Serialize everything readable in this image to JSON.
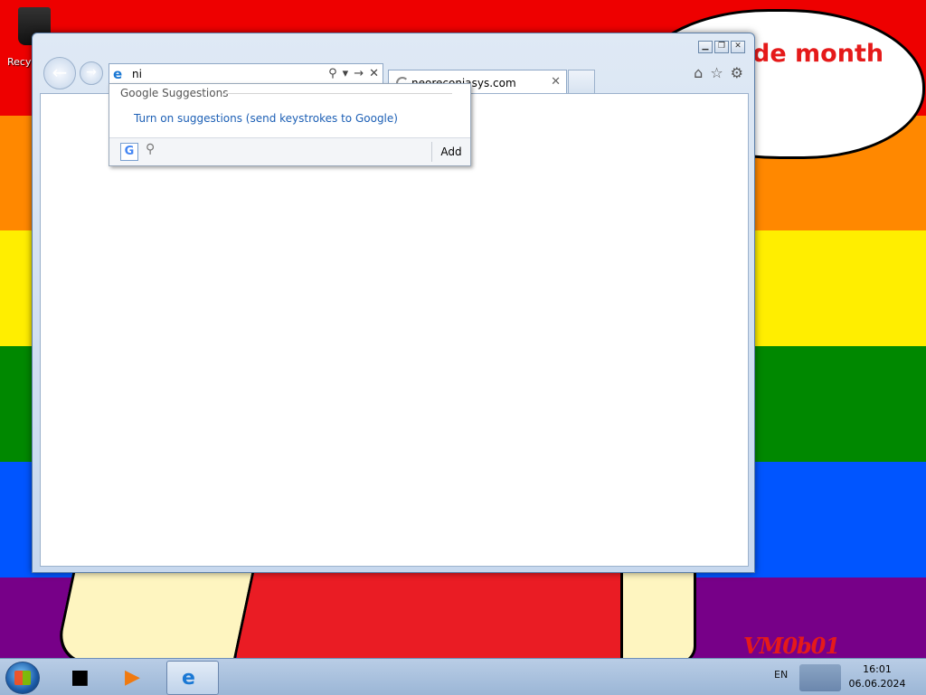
{
  "desktop": {
    "recycle_bin_label": "Recy",
    "wallpaper_text": "de month",
    "wallpaper_text2": "!",
    "signature": "VM0b01"
  },
  "browser": {
    "address_value": "ni",
    "tab_title": "neoreconiasys.com",
    "window_controls": [
      "minimize-icon",
      "restore-icon",
      "close-icon"
    ],
    "right_tools": [
      "home-icon",
      "favorites-star-icon",
      "settings-gear-icon"
    ]
  },
  "suggestions": {
    "header": "Google Suggestions",
    "link": "Turn on suggestions (send keystrokes to Google)",
    "add_label": "Add",
    "provider_icon": "G"
  },
  "taskbar": {
    "language": "EN",
    "time": "16:01",
    "date": "06.06.2024",
    "pinned": [
      "explorer-icon",
      "media-player-icon",
      "internet-explorer-icon"
    ]
  }
}
